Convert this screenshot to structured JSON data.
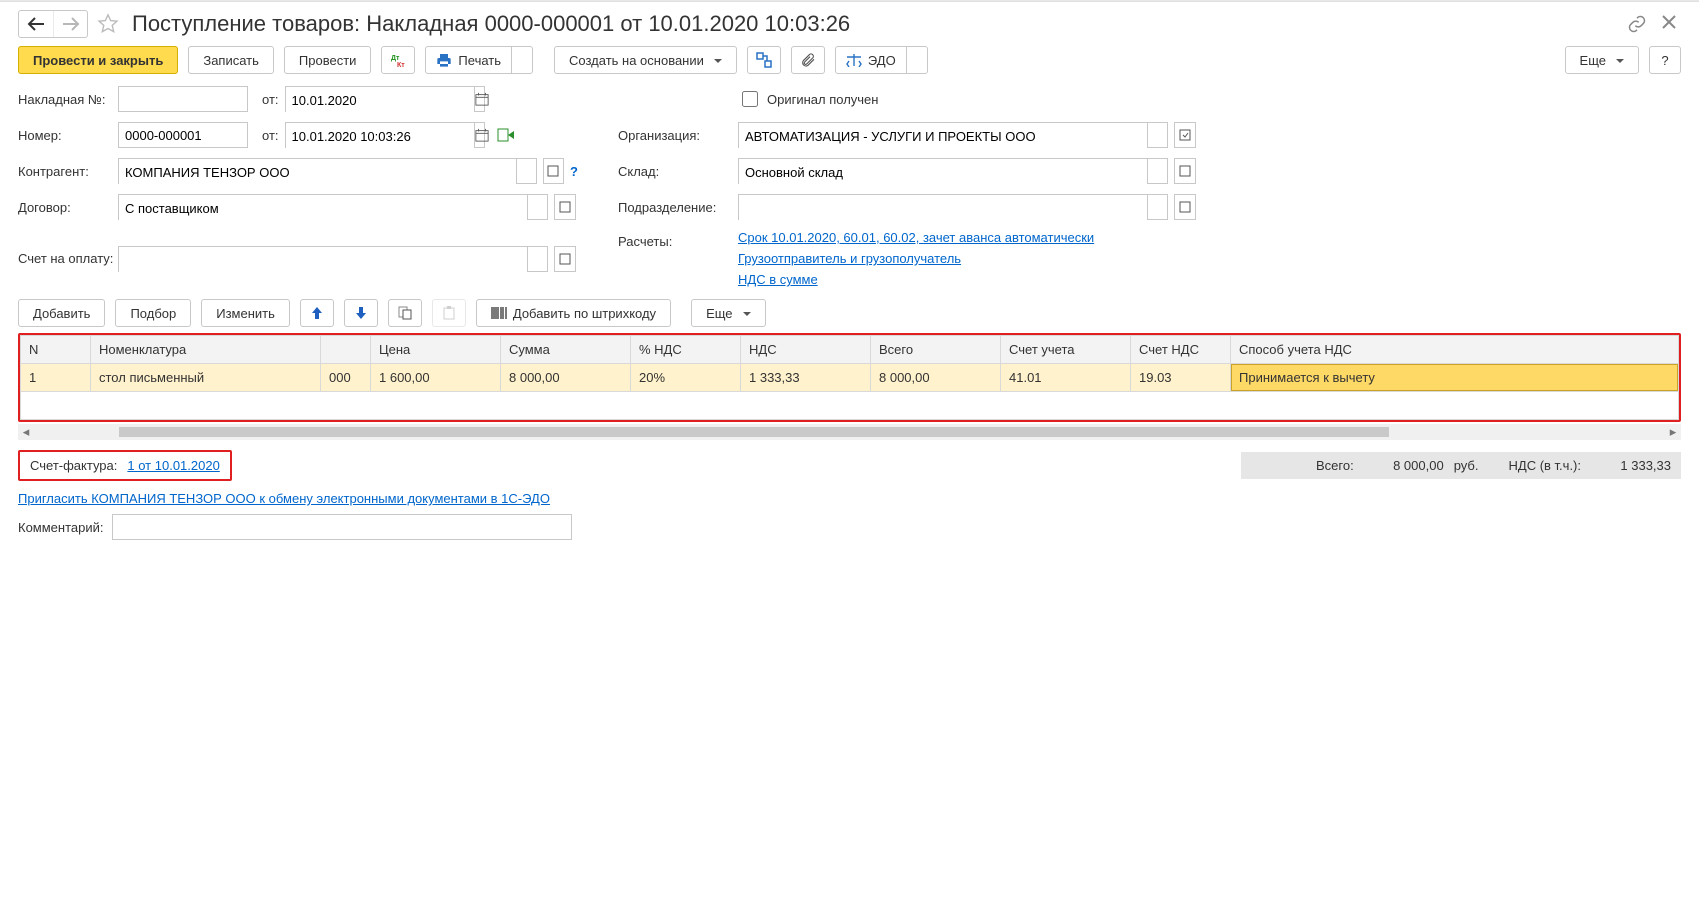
{
  "title": "Поступление товаров: Накладная 0000-000001 от 10.01.2020 10:03:26",
  "toolbar": {
    "post_close": "Провести и закрыть",
    "save": "Записать",
    "post": "Провести",
    "print": "Печать",
    "create_based": "Создать на основании",
    "edo": "ЭДО",
    "more": "Еще",
    "help": "?"
  },
  "labels": {
    "invoice_no": "Накладная №:",
    "from": "от:",
    "number": "Номер:",
    "counterparty": "Контрагент:",
    "contract": "Договор:",
    "payment_account": "Счет на оплату:",
    "original_received": "Оригинал получен",
    "organization": "Организация:",
    "warehouse": "Склад:",
    "department": "Подразделение:",
    "settlements": "Расчеты:"
  },
  "values": {
    "invoice_no": "",
    "invoice_date": "10.01.2020",
    "number": "0000-000001",
    "datetime": "10.01.2020 10:03:26",
    "counterparty": "КОМПАНИЯ ТЕНЗОР ООО",
    "contract": "С поставщиком",
    "payment_account": "",
    "organization": "АВТОМАТИЗАЦИЯ - УСЛУГИ И ПРОЕКТЫ ООО",
    "warehouse": "Основной склад",
    "department": ""
  },
  "links": {
    "settlements": "Срок 10.01.2020, 60.01, 60.02, зачет аванса автоматически",
    "shipper": "Грузоотправитель и грузополучатель",
    "vat": "НДС в сумме"
  },
  "tbl_toolbar": {
    "add": "Добавить",
    "select": "Подбор",
    "edit": "Изменить",
    "add_barcode": "Добавить по штрихкоду",
    "more": "Еще"
  },
  "columns": [
    "N",
    "Номенклатура",
    "",
    "Цена",
    "Сумма",
    "% НДС",
    "НДС",
    "Всего",
    "Счет учета",
    "Счет НДС",
    "Способ учета НДС"
  ],
  "rows": [
    {
      "n": "1",
      "item": "стол письменный",
      "c3": "000",
      "price": "1 600,00",
      "sum": "8 000,00",
      "vat_pct": "20%",
      "vat": "1 333,33",
      "total": "8 000,00",
      "acct": "41.01",
      "vat_acct": "19.03",
      "vat_method": "Принимается к вычету"
    }
  ],
  "footer": {
    "sf_label": "Счет-фактура:",
    "sf_link": "1 от 10.01.2020",
    "total_label": "Всего:",
    "total_value": "8 000,00",
    "currency": "руб.",
    "vat_label": "НДС (в т.ч.):",
    "vat_value": "1 333,33",
    "invite": "Пригласить КОМПАНИЯ ТЕНЗОР ООО к обмену электронными документами в 1С-ЭДО",
    "comment_label": "Комментарий:"
  }
}
